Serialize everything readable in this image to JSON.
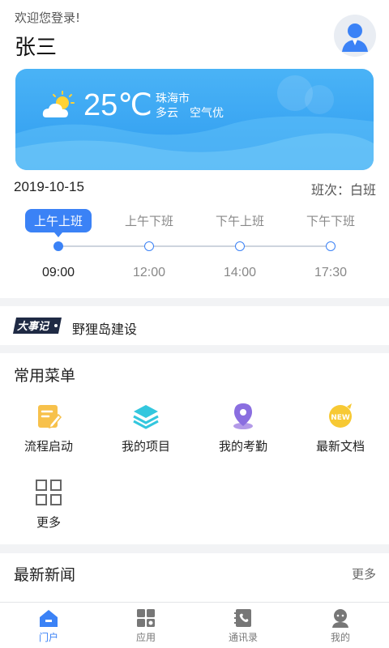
{
  "user": {
    "welcome": "欢迎您登录!",
    "name": "张三"
  },
  "weather": {
    "temperature": "25℃",
    "city": "珠海市",
    "condition": "多云",
    "air_quality": "空气优"
  },
  "attendance": {
    "date": "2019-10-15",
    "shift": "班次：白班",
    "steps": [
      {
        "label": "上午上班",
        "time": "09:00",
        "active": true
      },
      {
        "label": "上午下班",
        "time": "12:00",
        "active": false
      },
      {
        "label": "下午上班",
        "time": "14:00",
        "active": false
      },
      {
        "label": "下午下班",
        "time": "17:30",
        "active": false
      }
    ]
  },
  "events": {
    "tag": "大事记",
    "headline": "野狸岛建设"
  },
  "menu": {
    "title": "常用菜单",
    "items": [
      {
        "label": "流程启动",
        "icon": "edit-doc-icon"
      },
      {
        "label": "我的项目",
        "icon": "layers-icon"
      },
      {
        "label": "我的考勤",
        "icon": "location-pin-icon"
      },
      {
        "label": "最新文档",
        "icon": "new-badge-icon"
      },
      {
        "label": "更多",
        "icon": "grid-icon"
      }
    ]
  },
  "news": {
    "title": "最新新闻",
    "more": "更多"
  },
  "tabs": [
    {
      "label": "门户",
      "icon": "home-icon",
      "active": true
    },
    {
      "label": "应用",
      "icon": "apps-icon",
      "active": false
    },
    {
      "label": "通讯录",
      "icon": "contacts-icon",
      "active": false
    },
    {
      "label": "我的",
      "icon": "profile-icon",
      "active": false
    }
  ],
  "colors": {
    "accent": "#3b82f6",
    "weather_card": "#3aa6f4",
    "background": "#f2f3f5"
  }
}
